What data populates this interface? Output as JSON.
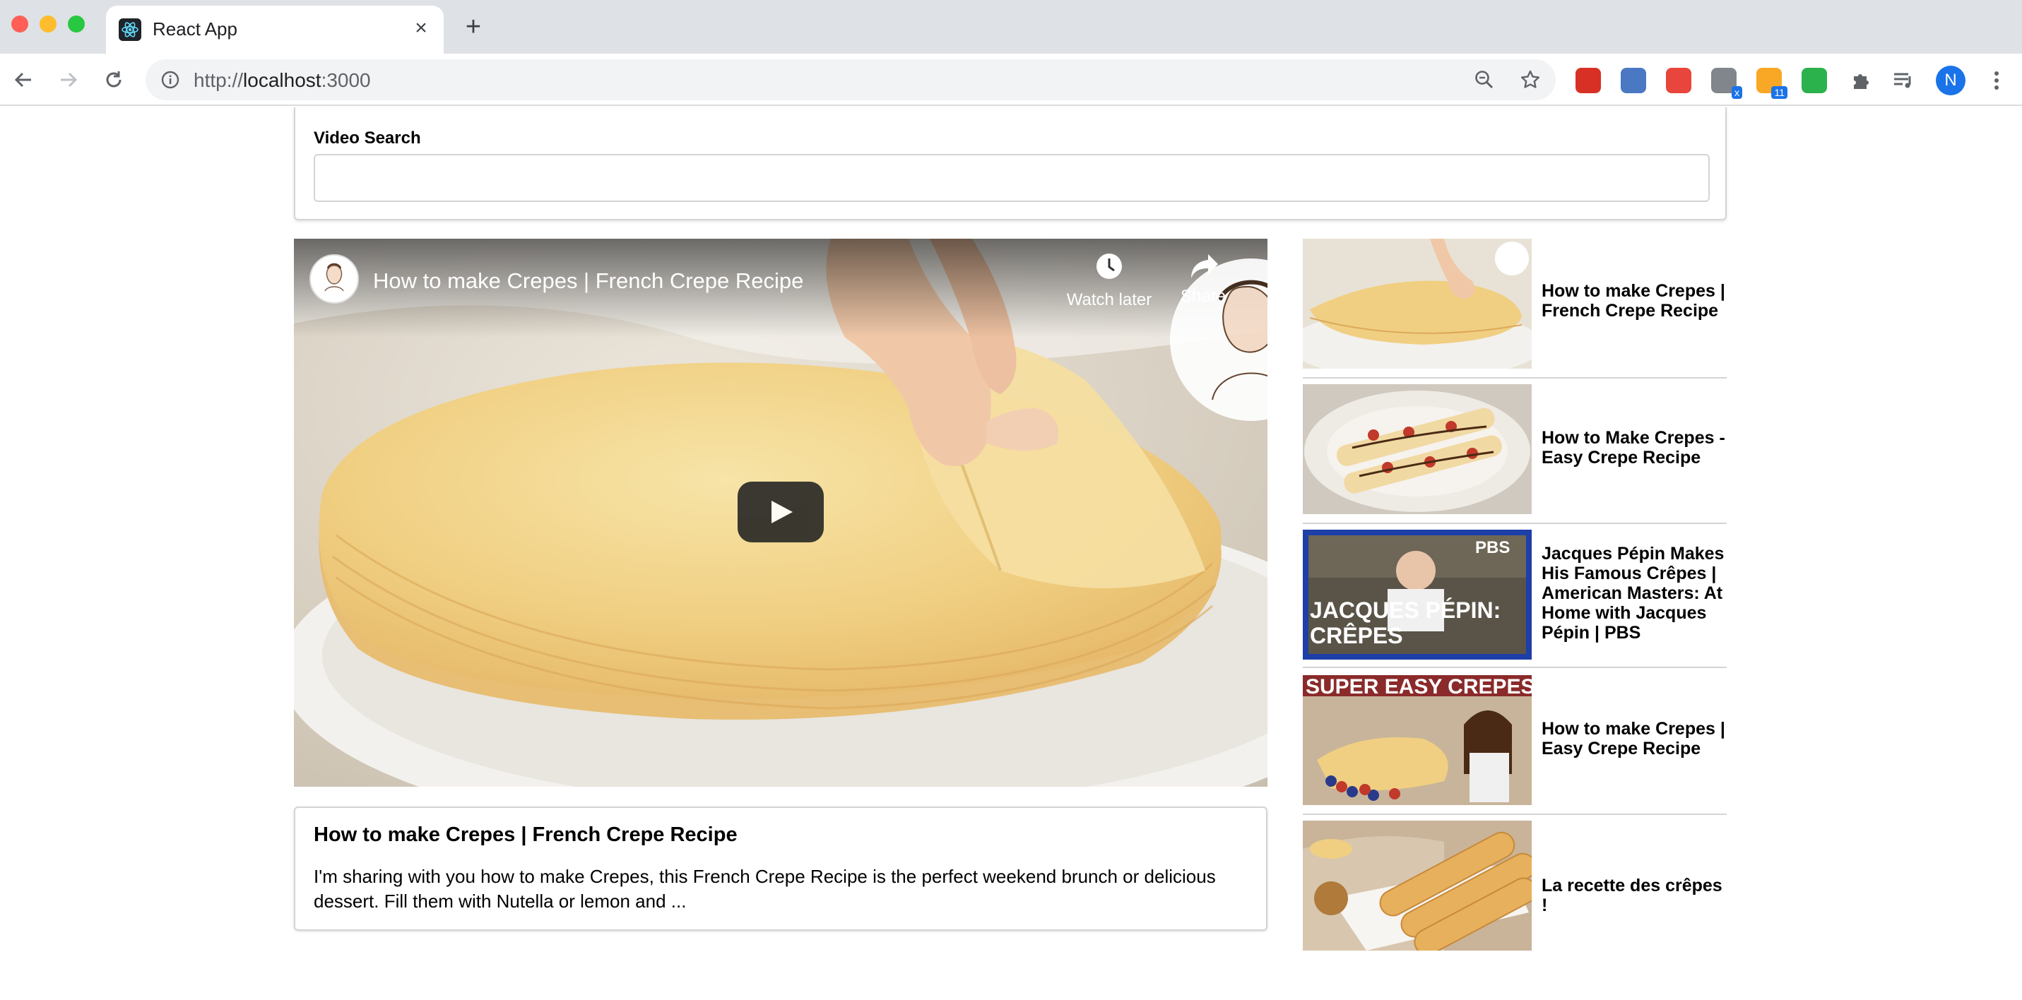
{
  "browser": {
    "tab_title": "React App",
    "url_scheme": "http://",
    "url_host": "localhost",
    "url_port": ":3000",
    "extensions": [
      {
        "name": "cookie-extension-icon",
        "color": "#d93025"
      },
      {
        "name": "privacy-extension-icon",
        "color": "#4a78c2"
      },
      {
        "name": "network-extension-icon",
        "color": "#e8453c"
      },
      {
        "name": "timer-extension-icon",
        "color": "#80868b",
        "badge": "x"
      },
      {
        "name": "rss-extension-icon",
        "color": "#f9a825",
        "badge": "11"
      },
      {
        "name": "feedly-extension-icon",
        "color": "#2bb24c"
      }
    ],
    "avatar_letter": "N"
  },
  "search": {
    "label": "Video Search",
    "value": "",
    "placeholder": ""
  },
  "player": {
    "title": "How to make Crepes | French Crepe Recipe",
    "watch_later_label": "Watch later",
    "share_label": "Share"
  },
  "selected_video": {
    "title": "How to make Crepes | French Crepe Recipe",
    "description": "I'm sharing with you how to make Crepes, this French Crepe Recipe is the perfect weekend brunch or delicious dessert. Fill them with Nutella or lemon and ..."
  },
  "video_list": [
    {
      "title": "How to make Crepes | French Crepe Recipe"
    },
    {
      "title": "How to Make Crepes - Easy Crepe Recipe"
    },
    {
      "title": "Jacques Pépin Makes His Famous Crêpes | American Masters: At Home with Jacques Pépin | PBS",
      "thumb_text": "JACQUES PÉPIN: CRÊPES",
      "thumb_badge": "PBS"
    },
    {
      "title": "How to make Crepes | Easy Crepe Recipe",
      "thumb_text": "SUPER EASY CREPES"
    },
    {
      "title": "La recette des crêpes !"
    }
  ]
}
